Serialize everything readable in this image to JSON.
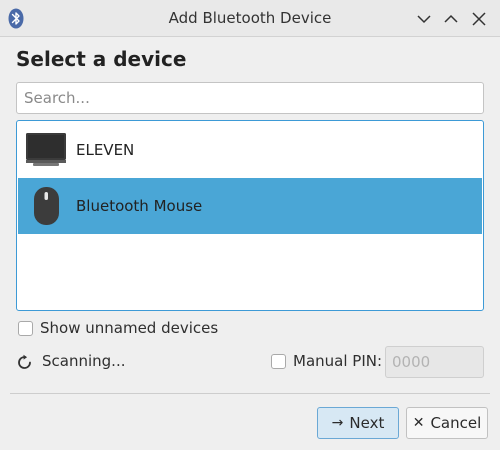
{
  "window": {
    "title": "Add Bluetooth Device"
  },
  "header": {
    "heading": "Select a device"
  },
  "search": {
    "placeholder": "Search..."
  },
  "devices": [
    {
      "label": "ELEVEN",
      "icon": "monitor-icon",
      "selected": false
    },
    {
      "label": "Bluetooth Mouse",
      "icon": "mouse-icon",
      "selected": true
    }
  ],
  "options": {
    "show_unnamed_label": "Show unnamed devices",
    "show_unnamed_checked": false,
    "status_text": "Scanning...",
    "manual_pin_label": "Manual PIN:",
    "manual_pin_checked": false,
    "manual_pin_placeholder": "0000"
  },
  "buttons": {
    "next_label": "Next",
    "next_icon": "→",
    "cancel_label": "Cancel",
    "cancel_icon": "✕"
  },
  "colors": {
    "selection": "#4aa6d6",
    "list_border": "#3d9ad6",
    "next_button_bg": "#d7e8f4",
    "bluetooth_icon": "#4a6aa8"
  }
}
